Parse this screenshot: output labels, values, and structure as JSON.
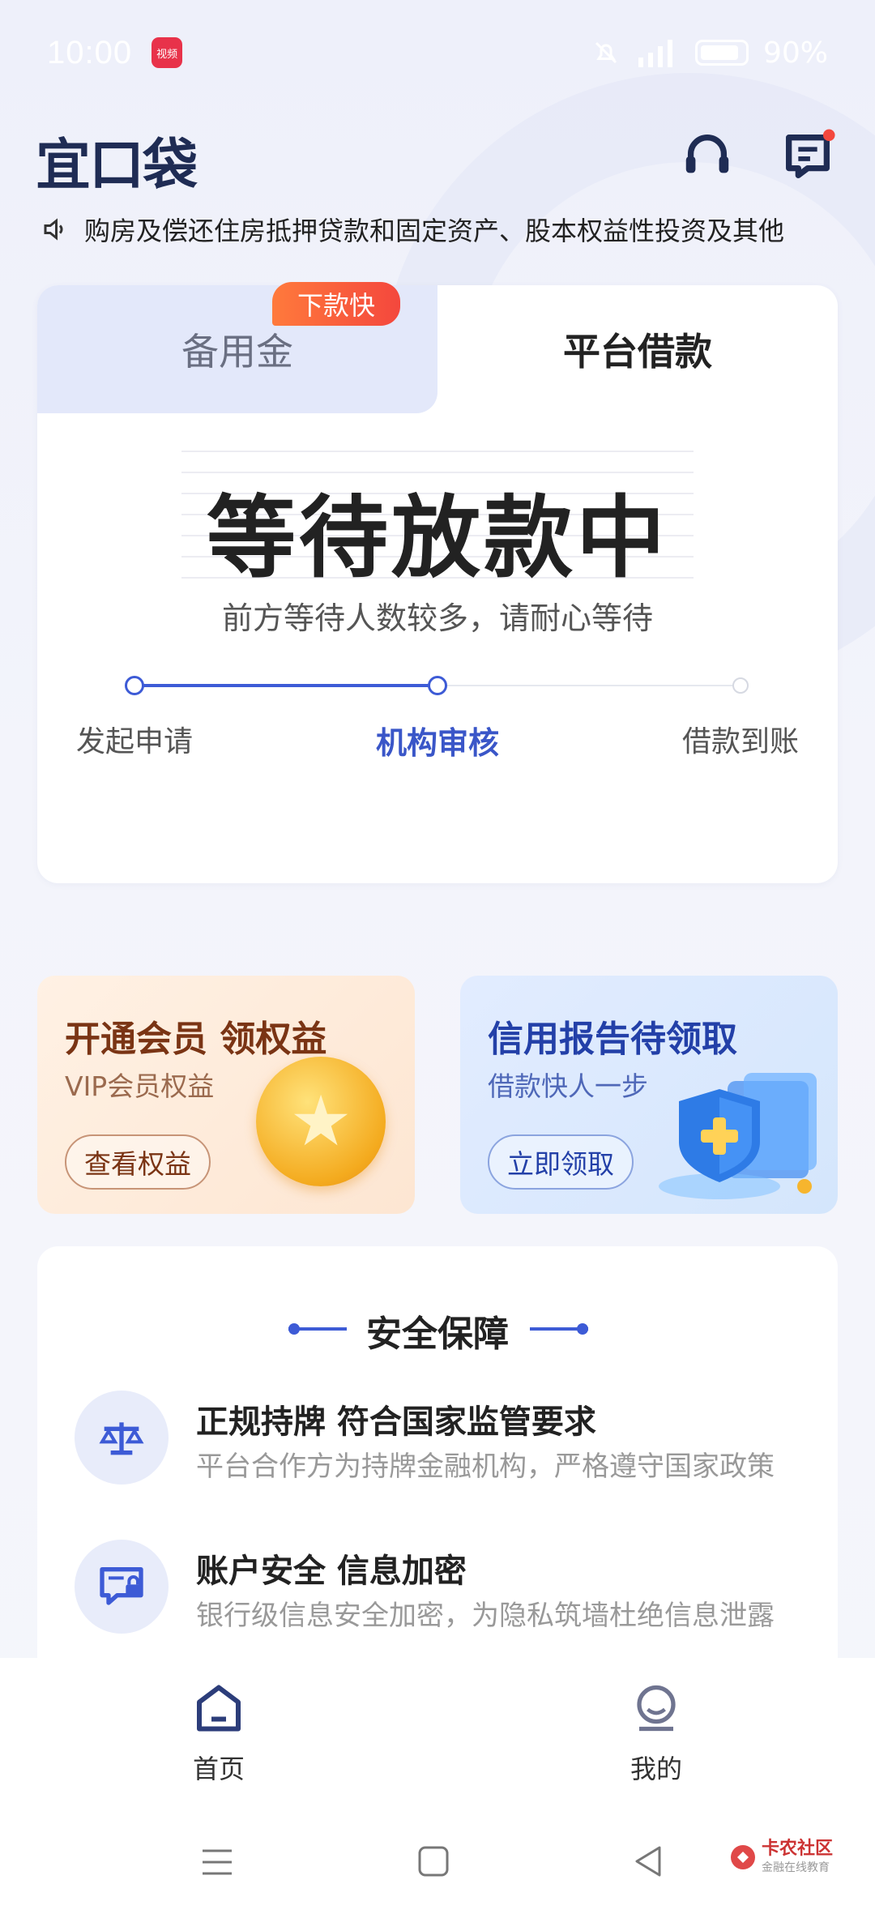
{
  "status_bar": {
    "time": "10:00",
    "battery": "90%",
    "app_badge": "视频"
  },
  "header": {
    "logo": "宜口袋",
    "support_icon": "headset-icon",
    "message_icon": "message-icon"
  },
  "marquee": {
    "text": "购房及偿还住房抵押贷款和固定资产、股本权益性投资及其他"
  },
  "loan_card": {
    "tabs": [
      {
        "label": "备用金"
      },
      {
        "label": "平台借款"
      }
    ],
    "badge": "下款快",
    "title": "等待放款中",
    "subtitle": "前方等待人数较多，请耐心等待",
    "steps": [
      {
        "label": "发起申请"
      },
      {
        "label": "机构审核"
      },
      {
        "label": "借款到账"
      }
    ],
    "active_step": 1
  },
  "promos": [
    {
      "title": "开通会员 领权益",
      "subtitle": "VIP会员权益",
      "button": "查看权益"
    },
    {
      "title": "信用报告待领取",
      "subtitle": "借款快人一步",
      "button": "立即领取"
    }
  ],
  "security": {
    "title": "安全保障",
    "items": [
      {
        "title": "正规持牌 符合国家监管要求",
        "desc": "平台合作方为持牌金融机构，严格遵守国家政策"
      },
      {
        "title": "账户安全 信息加密",
        "desc": "银行级信息安全加密，为隐私筑墙杜绝信息泄露"
      }
    ]
  },
  "tabbar": {
    "items": [
      {
        "label": "首页"
      },
      {
        "label": "我的"
      }
    ]
  },
  "watermark": {
    "title": "卡农社区",
    "subtitle": "金融在线教育"
  },
  "colors": {
    "accent": "#3d5bd6",
    "badge": "#f4473d",
    "tab_inactive_bg": "#e3e8fa"
  }
}
